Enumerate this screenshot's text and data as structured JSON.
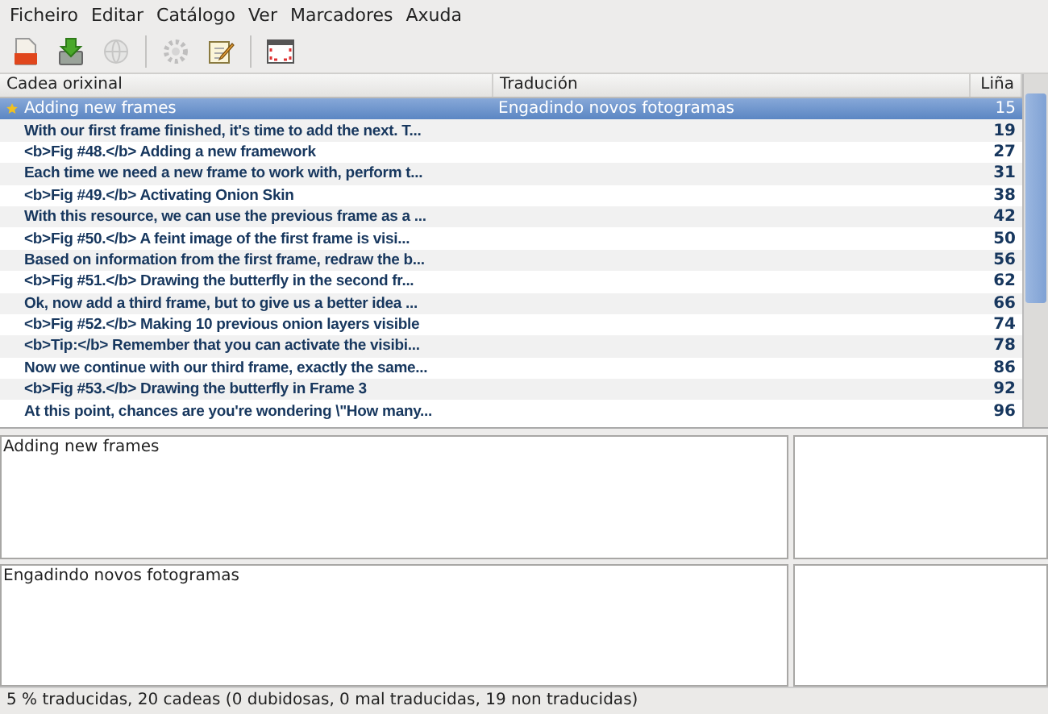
{
  "menu": [
    {
      "label": "Ficheiro"
    },
    {
      "label": "Editar"
    },
    {
      "label": "Catálogo"
    },
    {
      "label": "Ver"
    },
    {
      "label": "Marcadores"
    },
    {
      "label": "Axuda"
    }
  ],
  "toolbar": [
    {
      "kind": "open",
      "disabled": false
    },
    {
      "kind": "save",
      "disabled": false
    },
    {
      "kind": "globe",
      "disabled": true
    },
    {
      "kind": "sep"
    },
    {
      "kind": "gear",
      "disabled": true
    },
    {
      "kind": "edit",
      "disabled": false
    },
    {
      "kind": "sep"
    },
    {
      "kind": "window",
      "disabled": false
    }
  ],
  "table": {
    "columns": [
      "Cadea orixinal",
      "Tradución",
      "Liña"
    ],
    "rows": [
      {
        "source": "Adding new frames",
        "translation": "Engadindo novos fotogramas",
        "line": "15",
        "selected": true,
        "translated": true
      },
      {
        "source": "With our first frame finished, it's time to add the next. T...",
        "line": "19",
        "selected": false,
        "translated": false
      },
      {
        "source": "<b>Fig #48.</b> Adding a new framework",
        "line": "27",
        "selected": false,
        "translated": false
      },
      {
        "source": "Each time we need a new frame to work with, perform t...",
        "line": "31",
        "selected": false,
        "translated": false
      },
      {
        "source": "<b>Fig #49.</b> Activating Onion Skin",
        "line": "38",
        "selected": false,
        "translated": false
      },
      {
        "source": "With this resource, we can use the previous frame as a ...",
        "line": "42",
        "selected": false,
        "translated": false
      },
      {
        "source": "<b>Fig #50.</b> A feint image of the first frame is visi...",
        "line": "50",
        "selected": false,
        "translated": false
      },
      {
        "source": "Based on information from the first frame, redraw the b...",
        "line": "56",
        "selected": false,
        "translated": false
      },
      {
        "source": "<b>Fig #51.</b> Drawing the butterfly in the second fr...",
        "line": "62",
        "selected": false,
        "translated": false
      },
      {
        "source": "Ok, now add a third frame, but to give us a better idea ...",
        "line": "66",
        "selected": false,
        "translated": false
      },
      {
        "source": "<b>Fig #52.</b> Making 10 previous onion layers visible",
        "line": "74",
        "selected": false,
        "translated": false
      },
      {
        "source": "<b>Tip:</b> Remember that you can activate the visibi...",
        "line": "78",
        "selected": false,
        "translated": false
      },
      {
        "source": "Now we continue with our third frame, exactly the same...",
        "line": "86",
        "selected": false,
        "translated": false
      },
      {
        "source": "<b>Fig #53.</b> Drawing the butterfly in Frame 3",
        "line": "92",
        "selected": false,
        "translated": false
      },
      {
        "source": "At this point, chances are you're wondering \\\"How many...",
        "line": "96",
        "selected": false,
        "translated": false
      }
    ]
  },
  "source_editor": {
    "value": "Adding new frames"
  },
  "translation_editor": {
    "value": "Engadindo novos fotogramas"
  },
  "status_bar": "5 % traducidas, 20 cadeas (0 dubidosas, 0 mal traducidas, 19 non traducidas)"
}
